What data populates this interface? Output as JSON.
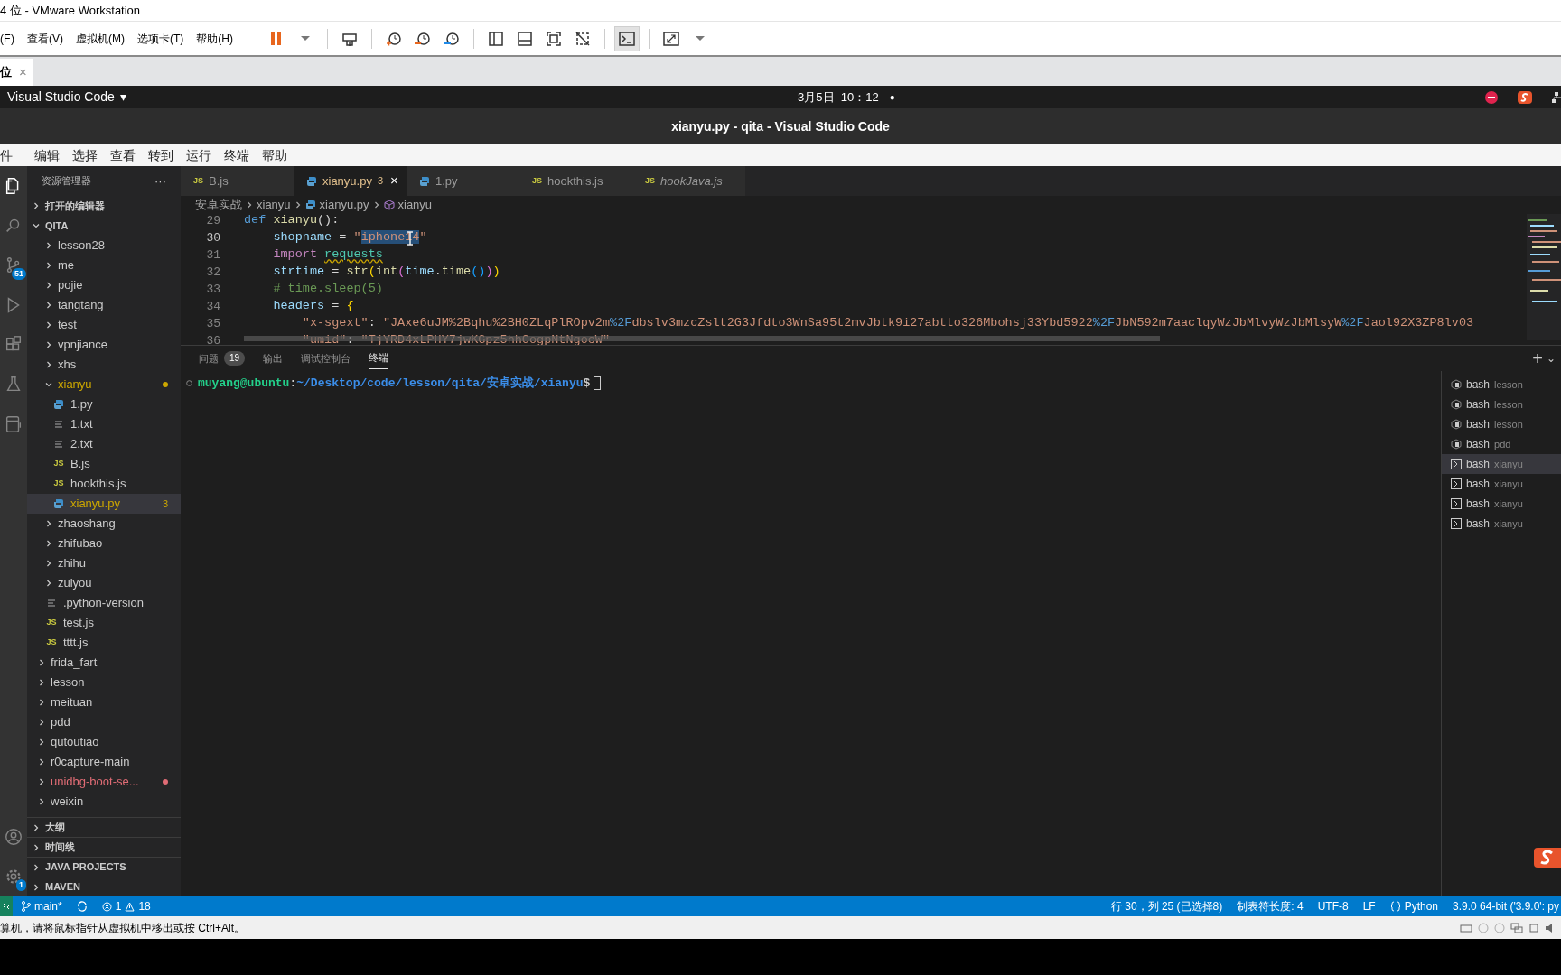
{
  "vmware": {
    "title": "4 位 - VMware Workstation",
    "menu": [
      "(E)",
      "查看(V)",
      "虚拟机(M)",
      "选项卡(T)",
      "帮助(H)"
    ],
    "toolbar": [
      {
        "kind": "pause",
        "selected": false
      },
      {
        "kind": "dropdown",
        "selected": false
      },
      {
        "kind": "sep"
      },
      {
        "kind": "send-keys",
        "selected": false
      },
      {
        "kind": "sep"
      },
      {
        "kind": "snapshot",
        "selected": false
      },
      {
        "kind": "revert",
        "selected": false
      },
      {
        "kind": "manage",
        "selected": false
      },
      {
        "kind": "sep"
      },
      {
        "kind": "sidebar",
        "selected": false
      },
      {
        "kind": "thumbs",
        "selected": false
      },
      {
        "kind": "fit",
        "selected": false
      },
      {
        "kind": "unity",
        "selected": false
      },
      {
        "kind": "sep"
      },
      {
        "kind": "console",
        "selected": true
      },
      {
        "kind": "sep"
      },
      {
        "kind": "fullscreen",
        "selected": false
      },
      {
        "kind": "dropdown",
        "selected": false
      }
    ],
    "tab": {
      "label": "位",
      "close": "×"
    },
    "status_message": "算机，请将鼠标指针从虚拟机中移出或按 Ctrl+Alt。"
  },
  "ubuntu_bar": {
    "app": "Visual Studio Code",
    "caret": "▾",
    "clock": "3月5日  10：12",
    "dot": "●"
  },
  "vscode": {
    "title": "xianyu.py - qita - Visual Studio Code",
    "menu": [
      "件",
      "编辑",
      "选择",
      "查看",
      "转到",
      "运行",
      "终端",
      "帮助"
    ],
    "activity": [
      {
        "kind": "files",
        "selected": true
      },
      {
        "kind": "search",
        "selected": false
      },
      {
        "kind": "scm",
        "selected": false,
        "badge": "51"
      },
      {
        "kind": "run",
        "selected": false
      },
      {
        "kind": "extensions",
        "selected": false
      },
      {
        "kind": "testing",
        "selected": false
      },
      {
        "kind": "remote",
        "selected": false
      }
    ],
    "activity_bottom": [
      {
        "kind": "account",
        "selected": false
      },
      {
        "kind": "settings",
        "selected": false,
        "badge": "1"
      }
    ],
    "sidebar": {
      "title": "资源管理器",
      "more": "···",
      "open_editors": {
        "label": "打开的编辑器",
        "expanded": false
      },
      "folder": {
        "label": "QITA",
        "expanded": true,
        "tree": [
          {
            "kind": "continued",
            "children": [
              {
                "name": "lesson28",
                "kind": "folder",
                "expanded": false,
                "selected": false
              },
              {
                "name": "me",
                "kind": "folder",
                "expanded": false,
                "selected": false
              },
              {
                "name": "pojie",
                "kind": "folder",
                "expanded": false,
                "selected": false
              },
              {
                "name": "tangtang",
                "kind": "folder",
                "expanded": false,
                "selected": false
              },
              {
                "name": "test",
                "kind": "folder",
                "expanded": false,
                "selected": false
              },
              {
                "name": "vpnjiance",
                "kind": "folder",
                "expanded": false,
                "selected": false
              },
              {
                "name": "xhs",
                "kind": "folder",
                "expanded": false,
                "selected": false
              },
              {
                "name": "xianyu",
                "kind": "folder",
                "expanded": true,
                "selected": false,
                "color": "#cca700",
                "children": [
                  {
                    "name": "1.py",
                    "kind": "py",
                    "selected": false
                  },
                  {
                    "name": "1.txt",
                    "kind": "txt",
                    "selected": false
                  },
                  {
                    "name": "2.txt",
                    "kind": "txt",
                    "selected": false
                  },
                  {
                    "name": "B.js",
                    "kind": "js",
                    "icon": "JS",
                    "selected": false
                  },
                  {
                    "name": "hookthis.js",
                    "kind": "js",
                    "icon": "JS",
                    "selected": false
                  },
                  {
                    "name": "xianyu.py",
                    "kind": "py",
                    "selected": true,
                    "color": "#cca700",
                    "badge": "3"
                  }
                ]
              },
              {
                "name": "zhaoshang",
                "kind": "folder",
                "expanded": false,
                "selected": false
              },
              {
                "name": "zhifubao",
                "kind": "folder",
                "expanded": false,
                "selected": false
              },
              {
                "name": "zhihu",
                "kind": "folder",
                "expanded": false,
                "selected": false
              },
              {
                "name": "zuiyou",
                "kind": "folder",
                "expanded": false,
                "selected": false
              },
              {
                "name": ".python-version",
                "kind": "txt",
                "selected": false
              },
              {
                "name": "test.js",
                "kind": "js",
                "icon": "JS",
                "selected": false
              },
              {
                "name": "tttt.js",
                "kind": "js",
                "icon": "JS",
                "selected": false
              }
            ]
          },
          {
            "name": "frida_fart",
            "kind": "folder",
            "expanded": false,
            "selected": false
          },
          {
            "name": "lesson",
            "kind": "folder",
            "expanded": false,
            "selected": false
          },
          {
            "name": "meituan",
            "kind": "folder",
            "expanded": false,
            "selected": false
          },
          {
            "name": "pdd",
            "kind": "folder",
            "expanded": false,
            "selected": false
          },
          {
            "name": "qutoutiao",
            "kind": "folder",
            "expanded": false,
            "selected": false
          },
          {
            "name": "r0capture-main",
            "kind": "folder",
            "expanded": false,
            "selected": false
          },
          {
            "name": "unidbg-boot-se...",
            "kind": "folder",
            "expanded": false,
            "selected": false,
            "color": "#e06c75"
          },
          {
            "name": "weixin",
            "kind": "folder",
            "expanded": false,
            "selected": false
          }
        ]
      },
      "bottom_sections": [
        {
          "label": "大纲",
          "expanded": false
        },
        {
          "label": "时间线",
          "expanded": false
        },
        {
          "label": "JAVA PROJECTS",
          "expanded": false
        },
        {
          "label": "MAVEN",
          "expanded": false
        }
      ]
    },
    "tabs": [
      {
        "label": "B.js",
        "kind": "js",
        "icon": "JS",
        "selected": false,
        "preview": false
      },
      {
        "label": "xianyu.py",
        "kind": "py",
        "selected": true,
        "preview": false,
        "badge": "3",
        "close": "×"
      },
      {
        "label": "1.py",
        "kind": "py",
        "selected": false,
        "preview": false
      },
      {
        "label": "hookthis.js",
        "kind": "js",
        "icon": "JS",
        "selected": false,
        "preview": false
      },
      {
        "label": "hookJava.js",
        "kind": "js",
        "icon": "JS",
        "selected": false,
        "preview": true
      }
    ],
    "breadcrumbs": [
      {
        "label": "安卓实战",
        "kind": "folder"
      },
      {
        "label": "xianyu",
        "kind": "folder"
      },
      {
        "label": "xianyu.py",
        "kind": "py"
      },
      {
        "label": "xianyu",
        "kind": "symbol"
      }
    ],
    "code": [
      {
        "number": "29",
        "current": false,
        "segments": [
          {
            "kind": "keyword",
            "text": "def "
          },
          {
            "kind": "func",
            "text": "xianyu"
          },
          {
            "kind": "plain",
            "text": "():"
          }
        ],
        "children": [
          {
            "number": "30",
            "current": true,
            "segments": [
              {
                "kind": "var",
                "text": "shopname"
              },
              {
                "kind": "plain",
                "text": " = "
              },
              {
                "kind": "string",
                "text": "\""
              },
              {
                "kind": "selection",
                "text": "iphone14"
              },
              {
                "kind": "string",
                "text": "\""
              }
            ]
          },
          {
            "number": "31",
            "current": false,
            "segments": [
              {
                "kind": "control",
                "text": "import "
              },
              {
                "kind": "warned",
                "text": "requests"
              }
            ]
          },
          {
            "number": "32",
            "current": false,
            "segments": [
              {
                "kind": "var",
                "text": "strtime"
              },
              {
                "kind": "plain",
                "text": " = "
              },
              {
                "kind": "func",
                "text": "str"
              },
              {
                "kind": "bracket1",
                "text": "("
              },
              {
                "kind": "func",
                "text": "int"
              },
              {
                "kind": "bracket2",
                "text": "("
              },
              {
                "kind": "var",
                "text": "time"
              },
              {
                "kind": "plain",
                "text": "."
              },
              {
                "kind": "func",
                "text": "time"
              },
              {
                "kind": "bracket3",
                "text": "()"
              },
              {
                "kind": "bracket2",
                "text": ")"
              },
              {
                "kind": "bracket1",
                "text": ")"
              }
            ]
          },
          {
            "number": "33",
            "current": false,
            "segments": [
              {
                "kind": "comment",
                "text": "# time.sleep(5)"
              }
            ]
          },
          {
            "number": "34",
            "current": false,
            "segments": [
              {
                "kind": "var",
                "text": "headers"
              },
              {
                "kind": "plain",
                "text": " = "
              },
              {
                "kind": "bracket1",
                "text": "{"
              }
            ],
            "children": [
              {
                "number": "35",
                "current": false,
                "segments": [
                  {
                    "kind": "string",
                    "text": "\"x-sgext\""
                  },
                  {
                    "kind": "plain",
                    "text": ": "
                  },
                  {
                    "kind": "string",
                    "text": "\"JAxe6uJM%2Bqhu%2BH0ZLqPlROpv2m"
                  },
                  {
                    "kind": "escape",
                    "text": "%2F"
                  },
                  {
                    "kind": "string",
                    "text": "dbslv3mzcZslt2G3Jfdto3WnSa95t2mvJbtk9i27abtto326Mbohsj33Ybd5922"
                  },
                  {
                    "kind": "escape",
                    "text": "%2F"
                  },
                  {
                    "kind": "string",
                    "text": "JbN592m7aaclqyWzJbMlvyWzJbMlsyW"
                  },
                  {
                    "kind": "escape",
                    "text": "%2F"
                  },
                  {
                    "kind": "string",
                    "text": "Jaol92X3ZP8lv03"
                  }
                ]
              },
              {
                "number": "36",
                "current": false,
                "segments": [
                  {
                    "kind": "string",
                    "text": "\"umid\""
                  },
                  {
                    "kind": "plain",
                    "text": ": "
                  },
                  {
                    "kind": "string",
                    "text": "\"TjYRD4xLPHY7jwKGpz5hhCogpNtNgocW\""
                  }
                ]
              }
            ]
          }
        ]
      }
    ],
    "panel": {
      "tabs": [
        {
          "label": "问题",
          "badge": "19",
          "selected": false
        },
        {
          "label": "输出",
          "selected": false
        },
        {
          "label": "调试控制台",
          "selected": false
        },
        {
          "label": "终端",
          "selected": true
        }
      ],
      "add": "+",
      "menu": "⌄",
      "prompt": {
        "user": "muyang@ubuntu",
        "sep": ":",
        "path": "~/Desktop/code/lesson/qita/安卓实战/xianyu",
        "symbol": "$"
      },
      "terminals": [
        {
          "name": "bash",
          "cwd": "lesson",
          "kind": "task",
          "selected": false
        },
        {
          "name": "bash",
          "cwd": "lesson",
          "kind": "task",
          "selected": false
        },
        {
          "name": "bash",
          "cwd": "lesson",
          "kind": "task",
          "selected": false
        },
        {
          "name": "bash",
          "cwd": "pdd",
          "kind": "task",
          "selected": false
        },
        {
          "name": "bash",
          "cwd": "xianyu",
          "kind": "shell",
          "selected": true
        },
        {
          "name": "bash",
          "cwd": "xianyu",
          "kind": "shell",
          "selected": false
        },
        {
          "name": "bash",
          "cwd": "xianyu",
          "kind": "shell",
          "selected": false
        },
        {
          "name": "bash",
          "cwd": "xianyu",
          "kind": "shell",
          "selected": false
        }
      ]
    },
    "status_bar": {
      "branch": "main*",
      "errors": "1",
      "warnings": "18",
      "position": "行 30，列 25 (已选择8)",
      "tab_size": "制表符长度: 4",
      "encoding": "UTF-8",
      "eol": "LF",
      "language": "Python",
      "interpreter": "3.9.0 64-bit ('3.9.0': py"
    }
  }
}
